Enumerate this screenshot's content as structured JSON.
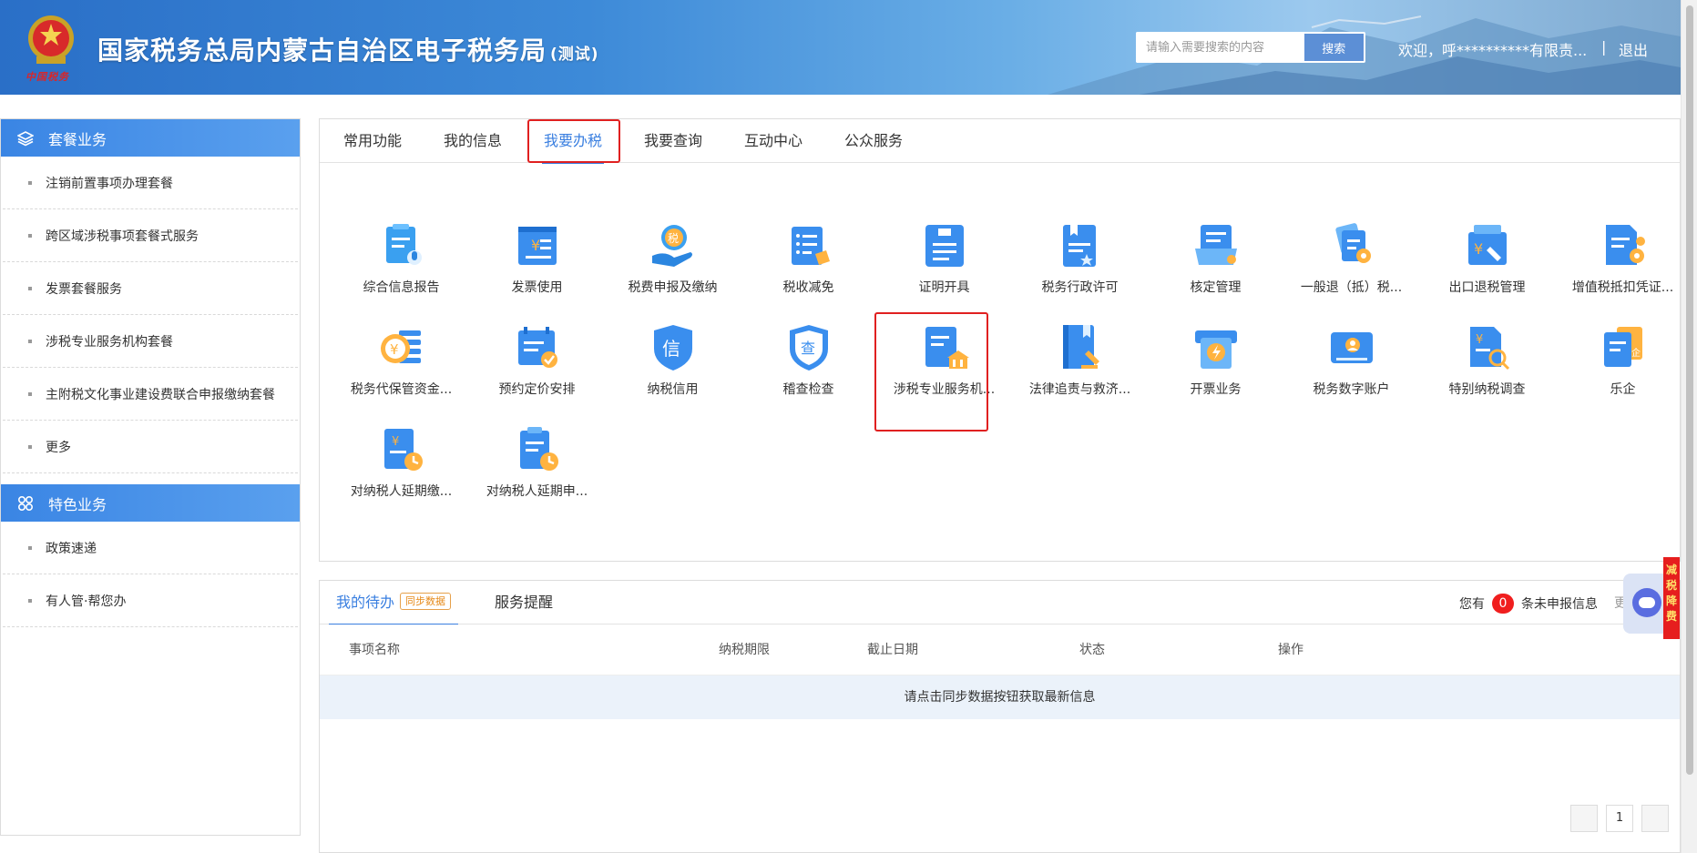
{
  "header": {
    "title": "国家税务总局内蒙古自治区电子税务局",
    "title_suffix": "(测试)",
    "signature": "中国税务",
    "search_placeholder": "请输入需要搜索的内容",
    "search_button": "搜索",
    "welcome": "欢迎，呼**********有限责...",
    "separator": "|",
    "logout": "退出"
  },
  "sidebar": {
    "group1": {
      "title": "套餐业务",
      "items": [
        "注销前置事项办理套餐",
        "跨区域涉税事项套餐式服务",
        "发票套餐服务",
        "涉税专业服务机构套餐",
        "主附税文化事业建设费联合申报缴纳套餐",
        "更多"
      ]
    },
    "group2": {
      "title": "特色业务",
      "items": [
        "政策速递",
        "有人管·帮您办"
      ]
    }
  },
  "tabs": [
    "常用功能",
    "我的信息",
    "我要办税",
    "我要查询",
    "互动中心",
    "公众服务"
  ],
  "active_tab_index": 2,
  "grid": [
    {
      "label": "综合信息报告",
      "icon": "report-mic-icon"
    },
    {
      "label": "发票使用",
      "icon": "invoice-yen-icon"
    },
    {
      "label": "税费申报及缴纳",
      "icon": "tax-hand-icon"
    },
    {
      "label": "税收减免",
      "icon": "tax-reduction-icon"
    },
    {
      "label": "证明开具",
      "icon": "certificate-icon"
    },
    {
      "label": "税务行政许可",
      "icon": "license-star-icon"
    },
    {
      "label": "核定管理",
      "icon": "assessment-icon"
    },
    {
      "label": "一般退（抵）税...",
      "icon": "refund-gear-icon"
    },
    {
      "label": "出口退税管理",
      "icon": "export-refund-icon"
    },
    {
      "label": "增值税抵扣凭证...",
      "icon": "vat-deduction-icon"
    },
    {
      "label": "税务代保管资金...",
      "icon": "custody-fund-icon"
    },
    {
      "label": "预约定价安排",
      "icon": "pricing-calendar-icon"
    },
    {
      "label": "纳税信用",
      "icon": "credit-shield-icon"
    },
    {
      "label": "稽查检查",
      "icon": "inspection-shield-icon"
    },
    {
      "label": "涉税专业服务机...",
      "icon": "service-agency-icon"
    },
    {
      "label": "法律追责与救济...",
      "icon": "legal-book-icon"
    },
    {
      "label": "开票业务",
      "icon": "invoicing-printer-icon"
    },
    {
      "label": "税务数字账户",
      "icon": "digital-account-icon"
    },
    {
      "label": "特别纳税调查",
      "icon": "special-investigation-icon"
    },
    {
      "label": "乐企",
      "icon": "leqi-doc-icon"
    },
    {
      "label": "对纳税人延期缴...",
      "icon": "deferral-payment-icon"
    },
    {
      "label": "对纳税人延期申...",
      "icon": "deferral-filing-icon"
    }
  ],
  "highlighted_item_index": 4,
  "todo": {
    "tab1": "我的待办",
    "sync_badge": "同步数据",
    "tab2": "服务提醒",
    "notice_prefix": "您有",
    "notice_count": "0",
    "notice_suffix": "条未申报信息",
    "more_partial": "更",
    "columns": [
      "事项名称",
      "纳税期限",
      "截止日期",
      "状态",
      "操作"
    ],
    "empty_message": "请点击同步数据按钮获取最新信息",
    "page": "1"
  },
  "float": {
    "tax_strip": [
      "减",
      "税",
      "降",
      "费"
    ]
  },
  "colors": {
    "accent": "#3a7fe0",
    "highlight_border": "#e02020",
    "badge_red": "#f01e1e"
  }
}
